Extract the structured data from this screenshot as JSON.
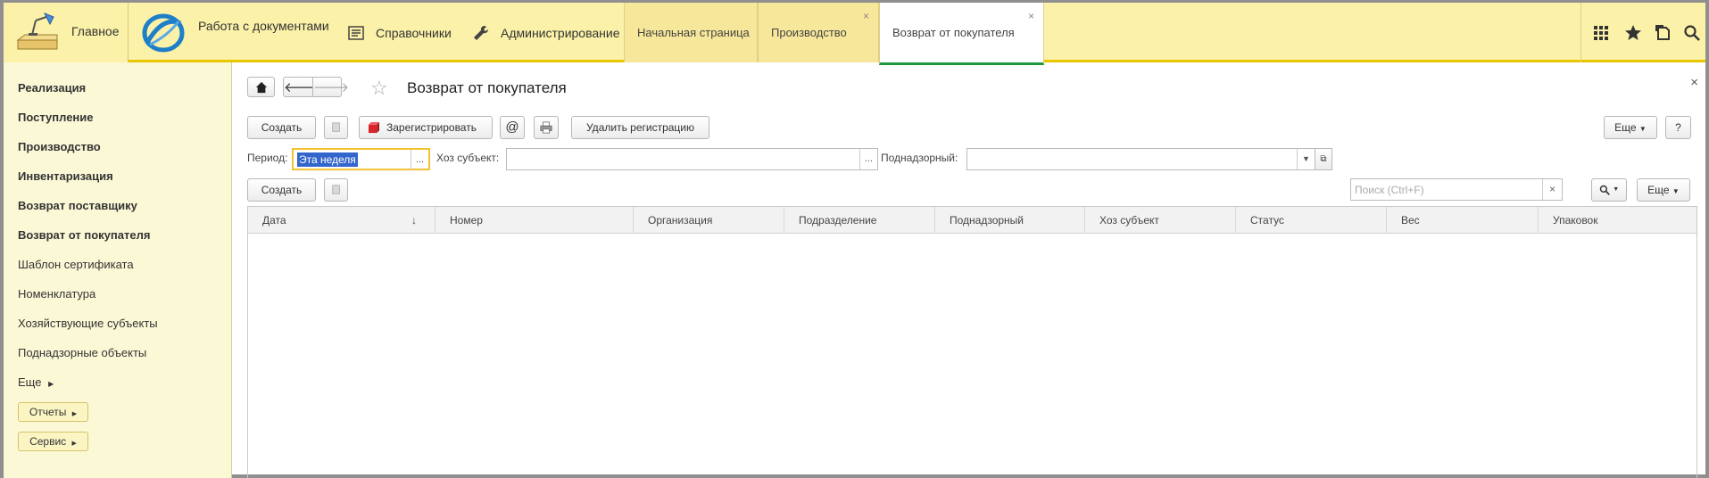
{
  "sections": {
    "home_label": "Главное",
    "docs_label": "Работа с документами",
    "reference_label": "Справочники",
    "admin_label": "Администрирование"
  },
  "tabs": [
    {
      "label": "Начальная страница"
    },
    {
      "label": "Производство",
      "close": "×"
    },
    {
      "label": "Возврат от покупателя",
      "close": "×"
    }
  ],
  "sidebar": {
    "items": [
      {
        "label": "Реализация"
      },
      {
        "label": "Поступление"
      },
      {
        "label": "Производство"
      },
      {
        "label": "Инвентаризация"
      },
      {
        "label": "Возврат поставщику"
      },
      {
        "label": "Возврат от покупателя"
      },
      {
        "label": "Шаблон сертификата"
      },
      {
        "label": "Номенклатура"
      },
      {
        "label": "Хозяйствующие субъекты"
      },
      {
        "label": "Поднадзорные объекты"
      },
      {
        "label": "Еще"
      }
    ],
    "reports_label": "Отчеты",
    "service_label": "Сервис"
  },
  "page": {
    "title": "Возврат от покупателя",
    "close": "×"
  },
  "toolbar": {
    "create_label": "Создать",
    "register_label": "Зарегистрировать",
    "email_label": "@",
    "delete_registration_label": "Удалить регистрацию",
    "more_label": "Еще",
    "help_label": "?"
  },
  "filters": {
    "period_label": "Период:",
    "period_value": "Эта неделя",
    "subject_label": "Хоз субъект:",
    "subject_value": "",
    "supervised_label": "Поднадзорный:",
    "supervised_value": "",
    "dots": "..."
  },
  "list_toolbar": {
    "create_label": "Создать",
    "search_placeholder": "Поиск (Ctrl+F)",
    "clear": "×",
    "more_label": "Еще"
  },
  "table": {
    "columns": [
      "Дата",
      "Номер",
      "Организация",
      "Подразделение",
      "Поднадзорный",
      "Хоз субъект",
      "Статус",
      "Вес",
      "Упаковок"
    ],
    "sort_indicator": "↓",
    "rows": []
  },
  "colors": {
    "topbar_bg": "#fbf1a8",
    "accent_yellow": "#e8c600",
    "active_tab_underline": "#1e9a3c",
    "sidebar_bg": "#fbf8d6"
  }
}
